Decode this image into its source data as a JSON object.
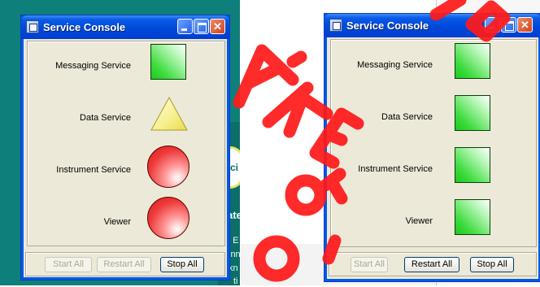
{
  "window_title": "Service Console",
  "left_window": {
    "services": [
      {
        "label": "Messaging Service",
        "status": "ok",
        "indicator": "green-square"
      },
      {
        "label": "Data Service",
        "status": "warning",
        "indicator": "yellow-triangle"
      },
      {
        "label": "Instrument Service",
        "status": "error",
        "indicator": "red-circle"
      },
      {
        "label": "Viewer",
        "status": "error",
        "indicator": "red-circle"
      }
    ],
    "buttons": [
      {
        "label": "Start All",
        "enabled": false
      },
      {
        "label": "Restart All",
        "enabled": false
      },
      {
        "label": "Stop All",
        "enabled": true
      }
    ]
  },
  "right_window": {
    "services": [
      {
        "label": "Messaging Service",
        "status": "ok",
        "indicator": "green-square"
      },
      {
        "label": "Data Service",
        "status": "ok",
        "indicator": "green-square"
      },
      {
        "label": "Instrument Service",
        "status": "ok",
        "indicator": "green-square"
      },
      {
        "label": "Viewer",
        "status": "ok",
        "indicator": "green-square"
      }
    ],
    "buttons": [
      {
        "label": "Start All",
        "enabled": false
      },
      {
        "label": "Restart All",
        "enabled": true
      },
      {
        "label": "Stop All",
        "enabled": true
      }
    ]
  },
  "background_fragments": {
    "logo_text": "Sci",
    "line_1": "ate",
    "line_2": "d E",
    "line_3": "inn",
    "line_4": "kn",
    "line_5": "ti"
  },
  "colors": {
    "title_bar": "#0049da",
    "ok": "#22c622",
    "warning": "#f2ec78",
    "error": "#e22b2b",
    "watermark": "#ff0000"
  }
}
